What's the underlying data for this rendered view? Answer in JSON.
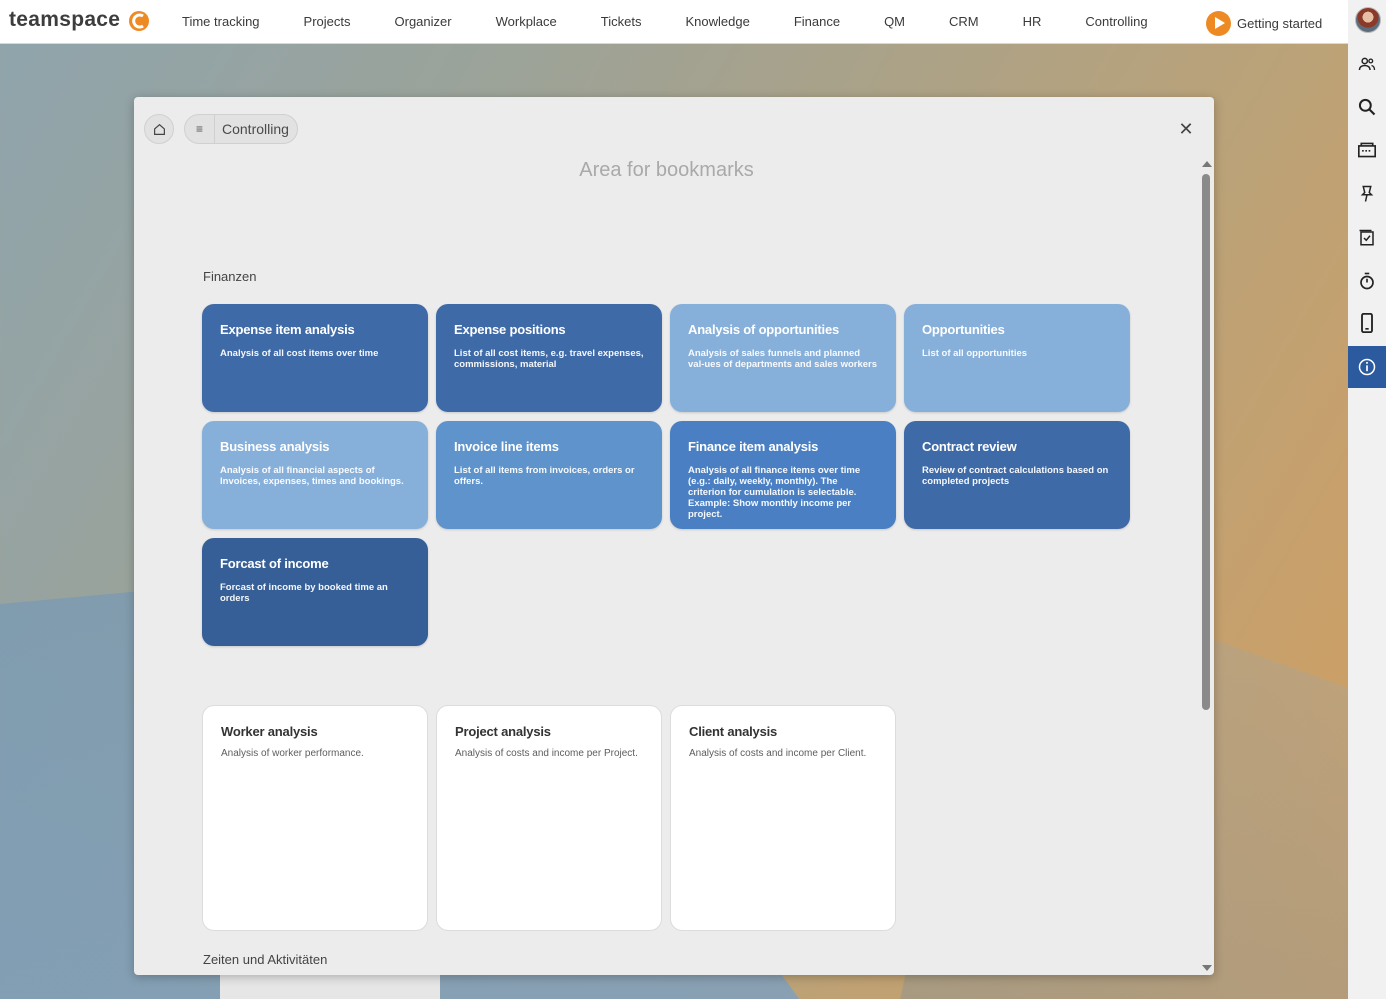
{
  "app": {
    "logo_text": "teamspace"
  },
  "nav": {
    "items": [
      "Time tracking",
      "Projects",
      "Organizer",
      "Workplace",
      "Tickets",
      "Knowledge",
      "Finance",
      "QM",
      "CRM",
      "HR",
      "Controlling"
    ],
    "getting_started": "Getting started"
  },
  "sidebar": {
    "icons": [
      "users-icon",
      "search-icon",
      "inbox-icon",
      "pin-icon",
      "checklist-icon",
      "timer-icon",
      "mobile-icon",
      "info-icon"
    ],
    "active": "info-icon",
    "active_color": "#2c5a9e"
  },
  "dialog": {
    "breadcrumb": "Controlling",
    "bookmarks_title": "Area for bookmarks",
    "sections": [
      {
        "label": "Finanzen",
        "tiles": [
          {
            "title": "Expense item analysis",
            "desc": "Analysis of all cost items over time",
            "color": "#3e6aa8"
          },
          {
            "title": "Expense positions",
            "desc": "List of all cost items, e.g. travel expenses, commissions, material",
            "color": "#3e6aa8"
          },
          {
            "title": "Analysis of opportunities",
            "desc": "Analysis of sales funnels and planned val-ues of departments and sales workers",
            "color": "#86afda"
          },
          {
            "title": "Opportunities",
            "desc": "List of all opportunities",
            "color": "#86afda"
          },
          {
            "title": "Business analysis",
            "desc": "Analysis of all financial aspects of Invoices, expenses, times and bookings.",
            "color": "#86afda"
          },
          {
            "title": "Invoice line items",
            "desc": "List of all items from invoices, orders or offers.",
            "color": "#5e93cb"
          },
          {
            "title": "Finance item analysis",
            "desc": "Analysis of all finance items over time (e.g.: daily, weekly, monthly). The criterion for cumulation is selectable. Example: Show monthly income per project.",
            "color": "#4a80c3"
          },
          {
            "title": "Contract review",
            "desc": "Review of contract calculations based on completed projects",
            "color": "#3e6aa8"
          },
          {
            "title": "Forcast of income",
            "desc": "Forcast of income by booked time an orders",
            "color": "#365f98"
          }
        ]
      },
      {
        "label": "",
        "tiles": [
          {
            "title": "Worker analysis",
            "desc": "Analysis of worker performance."
          },
          {
            "title": "Project analysis",
            "desc": "Analysis of costs and income per Project."
          },
          {
            "title": "Client analysis",
            "desc": "Analysis of costs and income per Client."
          }
        ]
      },
      {
        "label": "Zeiten und Aktivitäten",
        "tiles": []
      }
    ]
  },
  "colors": {
    "accent_orange": "#ee8a24",
    "tile_dark": "#3e6aa8",
    "tile_light": "#86afda"
  }
}
